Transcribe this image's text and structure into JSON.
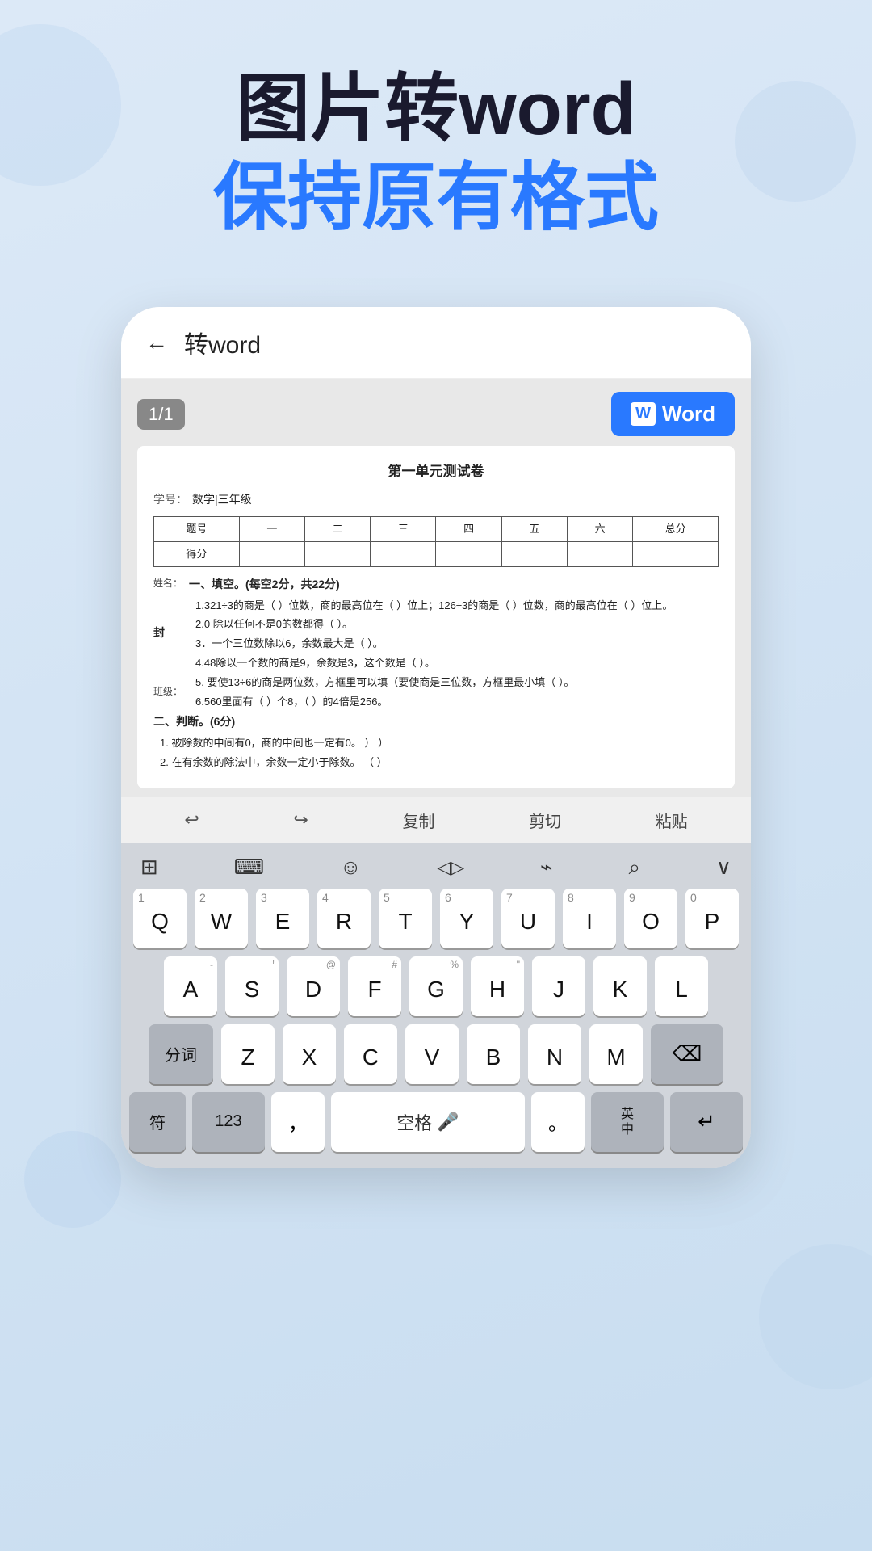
{
  "header": {
    "line1": "图片转word",
    "line2_prefix": "保持",
    "line2_highlight": "原有格式",
    "line2_suffix": ""
  },
  "appbar": {
    "back_label": "←",
    "title": "转word"
  },
  "toolbar": {
    "page_indicator": "1/1",
    "word_button": "Word"
  },
  "document": {
    "title": "第一单元测试卷",
    "subject_label": "学号：",
    "subject_value": "数学|三年级",
    "table_headers": [
      "题号",
      "一",
      "二",
      "三",
      "四",
      "五",
      "六",
      "总分"
    ],
    "table_scores": [
      "得分",
      "",
      "",
      "",
      "",
      "",
      "",
      ""
    ],
    "name_label": "姓名：",
    "name_value": "封",
    "class_label": "班级：",
    "section1": "一、填空。(每空2分，共22分)",
    "items": [
      "1.321÷3的商是（ ）位数，商的最高位在（ ）位上；126÷3的商是（ ）位数，商的最高位在（ ）位上。",
      "2.0 除以任何不是0的数都得（ ）。",
      "3．一个三位数除以6，余数最大是（ ）。",
      "4.48除以一个数的商是9，余数是3，这个数是（ ）。",
      "5. 要使13÷6的商是两位数，方框里可以填（要使商是三位数，方框里最小填（ ）。",
      "6.560里面有（   ）个8，（ ）的4倍是256。"
    ],
    "section2": "二、判断。(6分)",
    "judge_items": [
      "1. 被除数的中间有0，商的中间也一定有0。    ）              ）",
      "2. 在有余数的除法中，余数一定小于除数。   （ ）"
    ]
  },
  "edit_toolbar": {
    "undo": "↩",
    "redo": "↪",
    "copy": "复制",
    "cut": "剪切",
    "paste": "粘贴"
  },
  "keyboard": {
    "top_icons": [
      "⊞",
      "⌨",
      "☺",
      "◁▷",
      "⌁",
      "⌕",
      "∨"
    ],
    "row1": [
      {
        "num": "1",
        "letter": "Q"
      },
      {
        "num": "2",
        "letter": "W"
      },
      {
        "num": "3",
        "letter": "E"
      },
      {
        "num": "4",
        "letter": "R"
      },
      {
        "num": "5",
        "letter": "T"
      },
      {
        "num": "6",
        "letter": "Y"
      },
      {
        "num": "7",
        "letter": "U"
      },
      {
        "num": "8",
        "letter": "I"
      },
      {
        "num": "9",
        "letter": "O"
      },
      {
        "num": "0",
        "letter": "P"
      }
    ],
    "row2": [
      {
        "sym": "-",
        "letter": "A"
      },
      {
        "sym": "@",
        "letter": "S"
      },
      {
        "sym": "#",
        "letter": "D"
      },
      {
        "sym": "%",
        "letter": "F"
      },
      {
        "sym": "&",
        "letter": "G"
      },
      {
        "sym": "\"",
        "letter": "H"
      },
      {
        "sym": "",
        "letter": "J"
      },
      {
        "sym": "",
        "letter": "K"
      },
      {
        "sym": "",
        "letter": "L"
      }
    ],
    "special_left": "分词",
    "row3": [
      {
        "letter": "Z"
      },
      {
        "letter": "X"
      },
      {
        "letter": "C"
      },
      {
        "letter": "V"
      },
      {
        "letter": "B"
      },
      {
        "letter": "N"
      },
      {
        "letter": "M"
      }
    ],
    "delete_icon": "⌫",
    "bottom": {
      "fu": "符",
      "num123": "123",
      "comma": "，",
      "space": "空格",
      "mic_icon": "🎤",
      "period": "。",
      "lang": "英\n中",
      "return": "↵"
    }
  }
}
